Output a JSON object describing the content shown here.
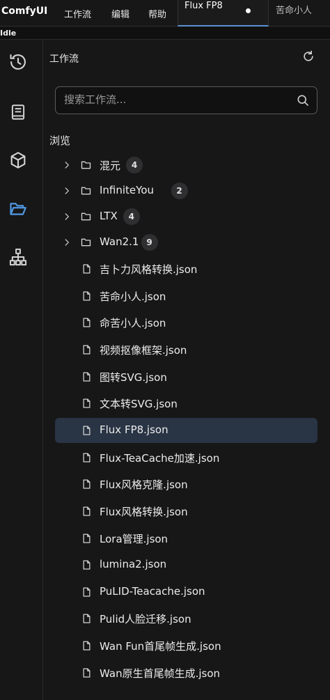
{
  "app": {
    "name": "ComfyUI"
  },
  "menu": [
    "工作流",
    "编辑",
    "帮助"
  ],
  "tabs": [
    {
      "label": "Flux FP8",
      "unsaved": true,
      "active": true
    },
    {
      "label": "苦命小人",
      "active": false
    }
  ],
  "status": "Idle",
  "panel": {
    "title": "工作流",
    "search_placeholder": "搜索工作流...",
    "section": "浏览",
    "folders": [
      {
        "name": "混元",
        "count": "4"
      },
      {
        "name": "InfiniteYou",
        "count": "2"
      },
      {
        "name": "LTX",
        "count": "4"
      },
      {
        "name": "Wan2.1",
        "count": "9"
      }
    ],
    "files": [
      "吉卜力风格转换.json",
      "苦命小人.json",
      "命苦小人.json",
      "视频抠像框架.json",
      "图转SVG.json",
      "文本转SVG.json",
      "Flux FP8.json",
      "Flux-TeaCache加速.json",
      "Flux风格克隆.json",
      "Flux风格转换.json",
      "Lora管理.json",
      "lumina2.json",
      "PuLID-Teacache.json",
      "Pulid人脸迁移.json",
      "Wan Fun首尾帧生成.json",
      "Wan原生首尾帧生成.json"
    ],
    "selected_file": "Flux FP8.json"
  },
  "sidebar_icons": [
    "history-icon",
    "book-icon",
    "cube-icon",
    "folder-open-icon",
    "sitemap-icon"
  ],
  "colors": {
    "accent": "#5a8fcf",
    "selected_row": "#293444",
    "background": "#171718"
  }
}
